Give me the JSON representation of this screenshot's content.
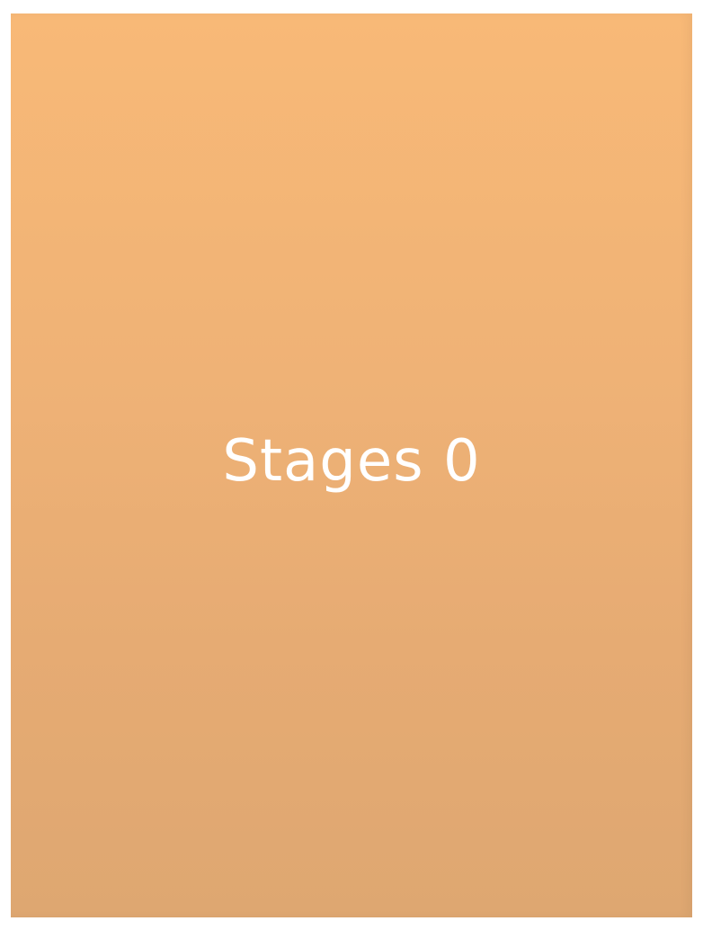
{
  "card": {
    "title": "Stages 0"
  },
  "colors": {
    "background": "#ffffff",
    "card_top": "#f8b977",
    "card_bottom": "#dea771",
    "title_text": "#ffffff"
  }
}
